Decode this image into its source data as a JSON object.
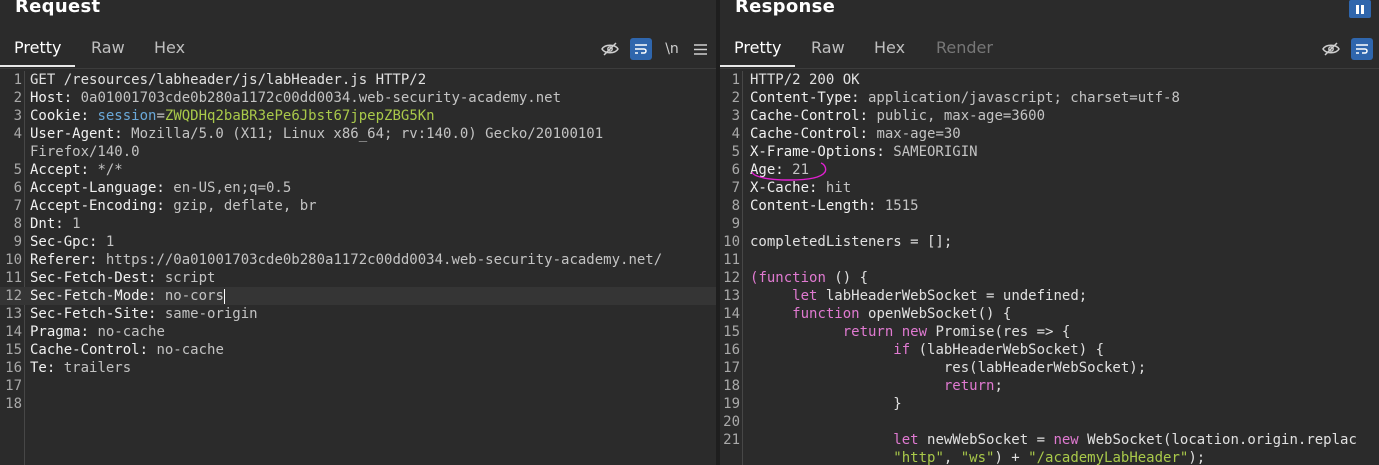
{
  "request": {
    "title": "Request",
    "tabs": [
      "Pretty",
      "Raw",
      "Hex"
    ],
    "active_tab": "Pretty",
    "tools": {
      "newline_label": "\\n"
    },
    "lines": [
      {
        "n": "1",
        "parts": [
          {
            "c": "plain",
            "t": "GET /resources/labheader/js/labHeader.js HTTP/2"
          }
        ]
      },
      {
        "n": "2",
        "parts": [
          {
            "c": "k",
            "t": "Host:"
          },
          {
            "c": "v",
            "t": " 0a01001703cde0b280a1172c00dd0034.web-security-academy.net"
          }
        ]
      },
      {
        "n": "3",
        "parts": [
          {
            "c": "k",
            "t": "Cookie:"
          },
          {
            "c": "sess",
            "t": " session"
          },
          {
            "c": "v",
            "t": "="
          },
          {
            "c": "cookie",
            "t": "ZWQDHq2baBR3ePe6Jbst67jpepZBG5Kn"
          }
        ]
      },
      {
        "n": "4",
        "parts": [
          {
            "c": "k",
            "t": "User-Agent:"
          },
          {
            "c": "v",
            "t": " Mozilla/5.0 (X11; Linux x86_64; rv:140.0) Gecko/20100101"
          }
        ]
      },
      {
        "n": "",
        "parts": [
          {
            "c": "v",
            "t": "Firefox/140.0"
          }
        ]
      },
      {
        "n": "5",
        "parts": [
          {
            "c": "k",
            "t": "Accept:"
          },
          {
            "c": "v",
            "t": " */*"
          }
        ]
      },
      {
        "n": "6",
        "parts": [
          {
            "c": "k",
            "t": "Accept-Language:"
          },
          {
            "c": "v",
            "t": " en-US,en;q=0.5"
          }
        ]
      },
      {
        "n": "7",
        "parts": [
          {
            "c": "k",
            "t": "Accept-Encoding:"
          },
          {
            "c": "v",
            "t": " gzip, deflate, br"
          }
        ]
      },
      {
        "n": "8",
        "parts": [
          {
            "c": "k",
            "t": "Dnt:"
          },
          {
            "c": "v",
            "t": " 1"
          }
        ]
      },
      {
        "n": "9",
        "parts": [
          {
            "c": "k",
            "t": "Sec-Gpc:"
          },
          {
            "c": "v",
            "t": " 1"
          }
        ]
      },
      {
        "n": "10",
        "parts": [
          {
            "c": "k",
            "t": "Referer:"
          },
          {
            "c": "v",
            "t": " https://0a01001703cde0b280a1172c00dd0034.web-security-academy.net/"
          }
        ]
      },
      {
        "n": "11",
        "parts": [
          {
            "c": "k",
            "t": "Sec-Fetch-Dest:"
          },
          {
            "c": "v",
            "t": " script"
          }
        ]
      },
      {
        "n": "12",
        "parts": [
          {
            "c": "k",
            "t": "Sec-Fetch-Mode:"
          },
          {
            "c": "v",
            "t": " no-cors"
          }
        ],
        "hl": true
      },
      {
        "n": "13",
        "parts": [
          {
            "c": "k",
            "t": "Sec-Fetch-Site:"
          },
          {
            "c": "v",
            "t": " same-origin"
          }
        ]
      },
      {
        "n": "14",
        "parts": [
          {
            "c": "k",
            "t": "Pragma:"
          },
          {
            "c": "v",
            "t": " no-cache"
          }
        ]
      },
      {
        "n": "15",
        "parts": [
          {
            "c": "k",
            "t": "Cache-Control:"
          },
          {
            "c": "v",
            "t": " no-cache"
          }
        ]
      },
      {
        "n": "16",
        "parts": [
          {
            "c": "k",
            "t": "Te:"
          },
          {
            "c": "v",
            "t": " trailers"
          }
        ]
      },
      {
        "n": "17",
        "parts": []
      },
      {
        "n": "18",
        "parts": []
      }
    ]
  },
  "response": {
    "title": "Response",
    "tabs": [
      "Pretty",
      "Raw",
      "Hex",
      "Render"
    ],
    "active_tab": "Pretty",
    "lines": [
      {
        "n": "1",
        "parts": [
          {
            "c": "plain",
            "t": "HTTP/2 200 OK"
          }
        ]
      },
      {
        "n": "2",
        "parts": [
          {
            "c": "k",
            "t": "Content-Type:"
          },
          {
            "c": "v",
            "t": " application/javascript; charset=utf-8"
          }
        ]
      },
      {
        "n": "3",
        "parts": [
          {
            "c": "k",
            "t": "Cache-Control:"
          },
          {
            "c": "v",
            "t": " public, max-age=3600"
          }
        ]
      },
      {
        "n": "4",
        "parts": [
          {
            "c": "k",
            "t": "Cache-Control:"
          },
          {
            "c": "v",
            "t": " max-age=30"
          }
        ]
      },
      {
        "n": "5",
        "parts": [
          {
            "c": "k",
            "t": "X-Frame-Options:"
          },
          {
            "c": "v",
            "t": " SAMEORIGIN"
          }
        ]
      },
      {
        "n": "6",
        "parts": [
          {
            "c": "k",
            "t": "Age:"
          },
          {
            "c": "v",
            "t": " 21"
          }
        ]
      },
      {
        "n": "7",
        "parts": [
          {
            "c": "k",
            "t": "X-Cache:"
          },
          {
            "c": "v",
            "t": " hit"
          }
        ]
      },
      {
        "n": "8",
        "parts": [
          {
            "c": "k",
            "t": "Content-Length:"
          },
          {
            "c": "v",
            "t": " 1515"
          }
        ]
      },
      {
        "n": "9",
        "parts": []
      },
      {
        "n": "10",
        "parts": [
          {
            "c": "plain",
            "t": "completedListeners = [];"
          }
        ]
      },
      {
        "n": "11",
        "parts": []
      },
      {
        "n": "12",
        "parts": [
          {
            "c": "kw",
            "t": "("
          },
          {
            "c": "kw",
            "t": "function"
          },
          {
            "c": "plain",
            "t": " () {"
          }
        ]
      },
      {
        "n": "13",
        "parts": [
          {
            "c": "plain",
            "t": "     "
          },
          {
            "c": "kw",
            "t": "let"
          },
          {
            "c": "plain",
            "t": " labHeaderWebSocket = undefined;"
          }
        ]
      },
      {
        "n": "14",
        "parts": [
          {
            "c": "plain",
            "t": "     "
          },
          {
            "c": "kw",
            "t": "function"
          },
          {
            "c": "plain",
            "t": " openWebSocket() {"
          }
        ]
      },
      {
        "n": "15",
        "parts": [
          {
            "c": "plain",
            "t": "           "
          },
          {
            "c": "kw",
            "t": "return"
          },
          {
            "c": "plain",
            "t": " "
          },
          {
            "c": "kw",
            "t": "new"
          },
          {
            "c": "plain",
            "t": " Promise(res => {"
          }
        ]
      },
      {
        "n": "16",
        "parts": [
          {
            "c": "plain",
            "t": "                 "
          },
          {
            "c": "kw",
            "t": "if"
          },
          {
            "c": "plain",
            "t": " (labHeaderWebSocket) {"
          }
        ]
      },
      {
        "n": "17",
        "parts": [
          {
            "c": "plain",
            "t": "                       res(labHeaderWebSocket);"
          }
        ]
      },
      {
        "n": "18",
        "parts": [
          {
            "c": "plain",
            "t": "                       "
          },
          {
            "c": "kw",
            "t": "return"
          },
          {
            "c": "plain",
            "t": ";"
          }
        ]
      },
      {
        "n": "19",
        "parts": [
          {
            "c": "plain",
            "t": "                 }"
          }
        ]
      },
      {
        "n": "20",
        "parts": []
      },
      {
        "n": "21",
        "parts": [
          {
            "c": "plain",
            "t": "                 "
          },
          {
            "c": "kw",
            "t": "let"
          },
          {
            "c": "plain",
            "t": " newWebSocket = "
          },
          {
            "c": "kw",
            "t": "new"
          },
          {
            "c": "plain",
            "t": " WebSocket(location.origin.replac"
          }
        ]
      },
      {
        "n": "",
        "parts": [
          {
            "c": "plain",
            "t": "                 "
          },
          {
            "c": "str",
            "t": "\"http\""
          },
          {
            "c": "plain",
            "t": ", "
          },
          {
            "c": "str",
            "t": "\"ws\""
          },
          {
            "c": "plain",
            "t": ") + "
          },
          {
            "c": "str",
            "t": "\"/academyLabHeader\""
          },
          {
            "c": "plain",
            "t": ");"
          }
        ]
      }
    ]
  },
  "colors": {
    "accent": "#2f66ad",
    "annotation": "#e020d0",
    "background": "#2b2b2b"
  }
}
